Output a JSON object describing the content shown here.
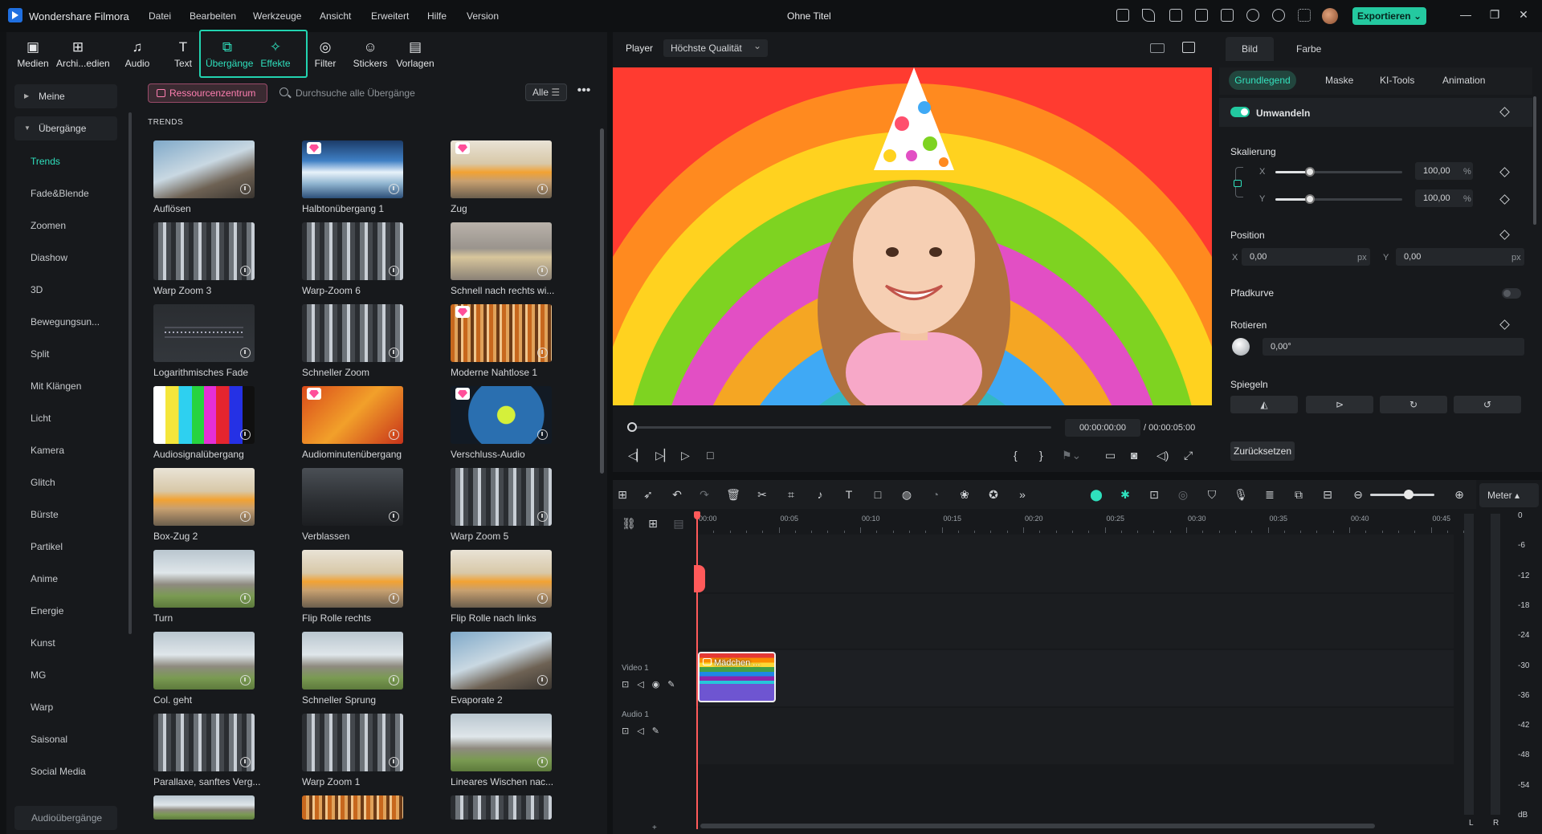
{
  "app": {
    "name": "Wondershare Filmora",
    "document_title": "Ohne Titel",
    "menu": [
      "Datei",
      "Bearbeiten",
      "Werkzeuge",
      "Ansicht",
      "Erweitert",
      "Hilfe",
      "Version"
    ],
    "export_label": "Exportieren"
  },
  "toolbar": {
    "tools": [
      {
        "label": "Medien",
        "glyph": "▣"
      },
      {
        "label": "Archi...edien",
        "glyph": "⊞"
      },
      {
        "label": "Audio",
        "glyph": "♫"
      },
      {
        "label": "Text",
        "glyph": "T"
      },
      {
        "label": "Übergänge",
        "glyph": "⧉"
      },
      {
        "label": "Effekte",
        "glyph": "✧"
      },
      {
        "label": "Filter",
        "glyph": "◎"
      },
      {
        "label": "Stickers",
        "glyph": "☺"
      },
      {
        "label": "Vorlagen",
        "glyph": "▤"
      }
    ]
  },
  "sidebar": {
    "sections": [
      "Meine",
      "Übergänge"
    ],
    "items": [
      "Trends",
      "Fade&Blende",
      "Zoomen",
      "Diashow",
      "3D",
      "Bewegungsun...",
      "Split",
      "Mit Klängen",
      "Licht",
      "Kamera",
      "Glitch",
      "Bürste",
      "Partikel",
      "Anime",
      "Energie",
      "Kunst",
      "MG",
      "Warp",
      "Saisonal",
      "Social Media"
    ],
    "bottom_item": "Audioübergänge"
  },
  "resources": {
    "center_label": "Ressourcenzentrum",
    "search_placeholder": "Durchsuche alle Übergänge",
    "filter_label": "Alle",
    "more_label": "•••",
    "section_label": "TRENDS"
  },
  "transitions": [
    {
      "label": "Auflösen",
      "premium": false,
      "style": "skate"
    },
    {
      "label": "Halbtonübergang 1",
      "premium": true,
      "style": "ice"
    },
    {
      "label": "Zug",
      "premium": true,
      "style": "train"
    },
    {
      "label": "Warp Zoom 3",
      "premium": false,
      "style": "city"
    },
    {
      "label": "Warp-Zoom 6",
      "premium": false,
      "style": "city"
    },
    {
      "label": "Schnell nach rechts wi...",
      "premium": false,
      "style": "blur"
    },
    {
      "label": "Logarithmisches Fade",
      "premium": false,
      "style": "wave"
    },
    {
      "label": "Schneller Zoom",
      "premium": false,
      "style": "city"
    },
    {
      "label": "Moderne Nahtlose 1",
      "premium": true,
      "style": "orange"
    },
    {
      "label": "Audiosignalübergang",
      "premium": false,
      "style": "bars"
    },
    {
      "label": "Audiominutenübergang",
      "premium": true,
      "style": "comic"
    },
    {
      "label": "Verschluss-Audio",
      "premium": true,
      "style": "ball"
    },
    {
      "label": "Box-Zug 2",
      "premium": false,
      "style": "train"
    },
    {
      "label": "Verblassen",
      "premium": false,
      "style": "dark"
    },
    {
      "label": "Warp Zoom 5",
      "premium": false,
      "style": "city"
    },
    {
      "label": "Turn",
      "premium": false,
      "style": "house"
    },
    {
      "label": "Flip Rolle rechts",
      "premium": false,
      "style": "train"
    },
    {
      "label": "Flip Rolle nach links",
      "premium": false,
      "style": "train"
    },
    {
      "label": "Col. geht",
      "premium": false,
      "style": "house"
    },
    {
      "label": "Schneller Sprung",
      "premium": false,
      "style": "house"
    },
    {
      "label": "Evaporate 2",
      "premium": false,
      "style": "skate"
    },
    {
      "label": "Parallaxe, sanftes Verg...",
      "premium": false,
      "style": "city"
    },
    {
      "label": "Warp Zoom 1",
      "premium": false,
      "style": "city"
    },
    {
      "label": "Lineares Wischen nac...",
      "premium": false,
      "style": "house"
    },
    {
      "label": "",
      "premium": false,
      "style": "house"
    },
    {
      "label": "",
      "premium": false,
      "style": "orange"
    },
    {
      "label": "",
      "premium": false,
      "style": "city"
    }
  ],
  "player": {
    "label": "Player",
    "quality": "Höchste Qualität",
    "current_time": "00:00:00:00",
    "total_time": "/ 00:00:05:00",
    "progress": 0
  },
  "properties": {
    "tabs": [
      "Bild",
      "Farbe"
    ],
    "subtabs": [
      "Grundlegend",
      "Maske",
      "KI-Tools",
      "Animation"
    ],
    "transform_label": "Umwandeln",
    "scale_label": "Skalierung",
    "scale_x_label": "X",
    "scale_y_label": "Y",
    "scale_x": "100,00",
    "scale_y": "100,00",
    "scale_x_fraction": 0.27,
    "scale_y_fraction": 0.27,
    "percent": "%",
    "position_label": "Position",
    "pos_x_label": "X",
    "pos_y_label": "Y",
    "pos_x": "0,00",
    "pos_y": "0,00",
    "px": "px",
    "path_curve_label": "Pfadkurve",
    "rotate_label": "Rotieren",
    "rotate_value": "0,00°",
    "mirror_label": "Spiegeln",
    "reset_label": "Zurücksetzen"
  },
  "timeline": {
    "ticks": [
      "00:00",
      "00:05",
      "00:10",
      "00:15",
      "00:20",
      "00:25",
      "00:30",
      "00:35",
      "00:40",
      "00:45"
    ],
    "video_track": "Video 1",
    "audio_track": "Audio 1",
    "clip_label": "Mädchen ...",
    "meter_label": "Meter",
    "meter_scale": [
      "0",
      "-6",
      "-12",
      "-18",
      "-24",
      "-30",
      "-36",
      "-42",
      "-48",
      "-54",
      "dB"
    ],
    "meter_channels": [
      "L",
      "R"
    ],
    "zoom_fraction": 0.6
  },
  "colors": {
    "accent": "#22d3b0",
    "premium": "#ff4f99",
    "playhead": "#ff5a5a"
  }
}
